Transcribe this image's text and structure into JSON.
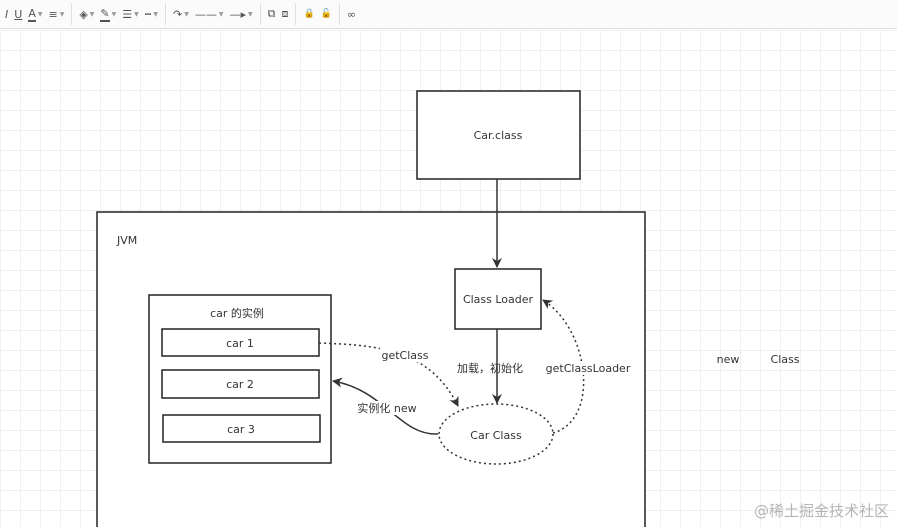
{
  "toolbar": {
    "items": [
      {
        "icon": "italic-icon",
        "glyph": "I"
      },
      {
        "icon": "underline-icon",
        "glyph": "U"
      },
      {
        "icon": "font-color-icon",
        "glyph": "A"
      },
      {
        "icon": "align-icon",
        "glyph": "≡"
      },
      {
        "icon": "fill-color-icon",
        "glyph": "◈"
      },
      {
        "icon": "line-color-icon",
        "glyph": "✎"
      },
      {
        "icon": "line-width-icon",
        "glyph": "☰"
      },
      {
        "icon": "dash-style-icon",
        "glyph": "┅"
      },
      {
        "icon": "connector-icon",
        "glyph": "↷"
      },
      {
        "icon": "line-style-icon",
        "glyph": "——"
      },
      {
        "icon": "arrow-style-icon",
        "glyph": "—▸"
      },
      {
        "icon": "bring-front-icon",
        "glyph": "⧉"
      },
      {
        "icon": "send-back-icon",
        "glyph": "⧈"
      },
      {
        "icon": "lock-icon",
        "glyph": "🔒"
      },
      {
        "icon": "unlock-icon",
        "glyph": "🔓"
      },
      {
        "icon": "link-icon",
        "glyph": "∞"
      }
    ]
  },
  "diagram": {
    "car_class_file": "Car.class",
    "jvm_label": "JVM",
    "class_loader": "Class Loader",
    "instances_title": "car 的实例",
    "instances": [
      "car 1",
      "car 2",
      "car 3"
    ],
    "car_class": "Car Class",
    "edge_get_class": "getClass",
    "edge_load_init": "加载，初始化",
    "edge_get_class_loader": "getClassLoader",
    "edge_instantiate": "实例化 new",
    "free_text_new": "new",
    "free_text_class": "Class"
  },
  "watermark": "@稀土掘金技术社区"
}
